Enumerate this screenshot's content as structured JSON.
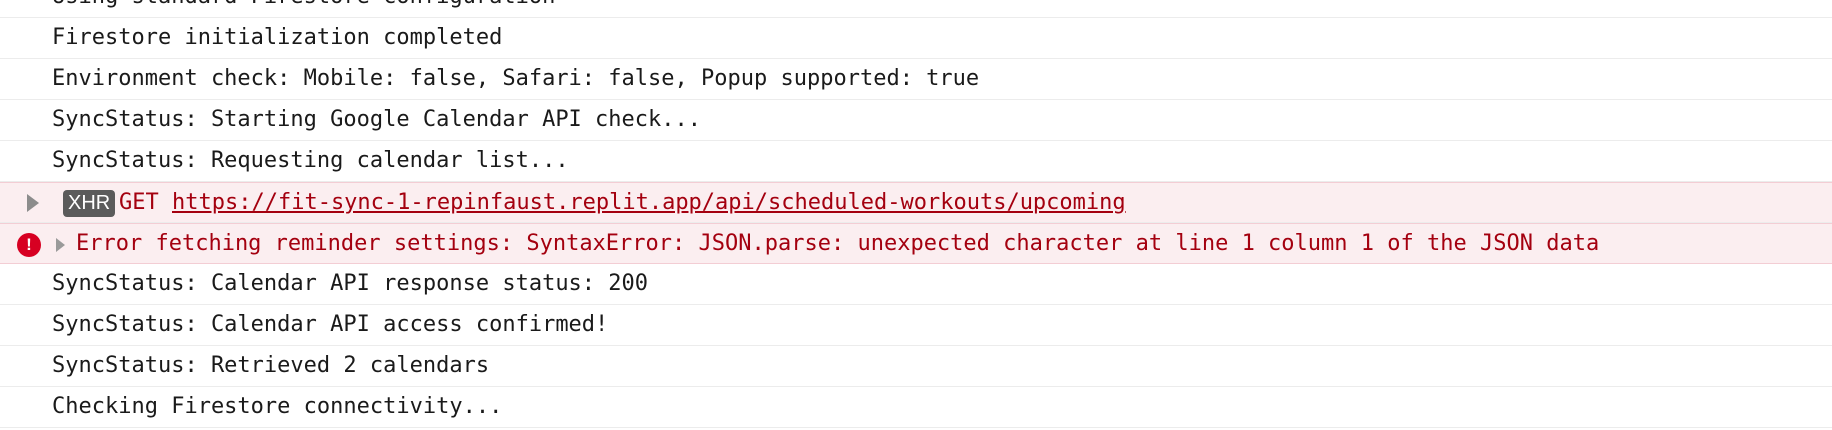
{
  "console": {
    "rows_before": [
      "Using standard Firestore configuration",
      "Firestore initialization completed",
      "Environment check: Mobile: false, Safari: false, Popup supported: true",
      "SyncStatus: Starting Google Calendar API check...",
      "SyncStatus: Requesting calendar list..."
    ],
    "xhr": {
      "badge": "XHR",
      "method": "GET",
      "url": "https://fit-sync-1-repinfaust.replit.app/api/scheduled-workouts/upcoming"
    },
    "error": {
      "icon": "!",
      "message": "Error fetching reminder settings: SyntaxError: JSON.parse: unexpected character at line 1 column 1 of the JSON data"
    },
    "rows_after": [
      "SyncStatus: Calendar API response status: 200",
      "SyncStatus: Calendar API access confirmed!",
      "SyncStatus: Retrieved 2 calendars",
      "Checking Firestore connectivity..."
    ]
  },
  "colors": {
    "error_text": "#a4000f",
    "error_background": "#fbeef0",
    "error_icon": "#d70022",
    "badge_background": "#5b5b5b"
  },
  "icons": {
    "expand": "chevron-right-icon",
    "error": "error-circle-icon"
  }
}
